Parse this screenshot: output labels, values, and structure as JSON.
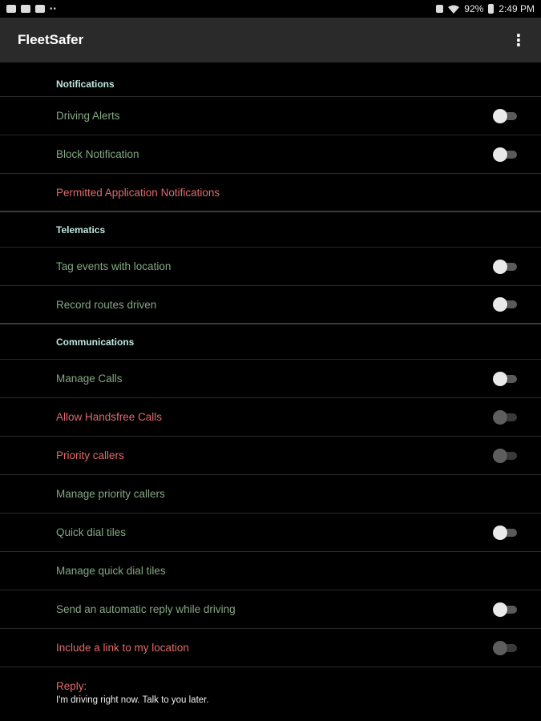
{
  "status_bar": {
    "battery": "92%",
    "time": "2:49 PM",
    "left_icons": [
      "image-icon",
      "settings-icon",
      "mail-icon"
    ],
    "right_icons": [
      "battery-saver-icon",
      "wifi-icon",
      "battery-icon"
    ]
  },
  "app_bar": {
    "title": "FleetSafer",
    "overflow_icon": "more-vert-icon"
  },
  "colors": {
    "section_header": "#bfe6e0",
    "enabled_item": "#84a884",
    "warning_item": "#e06a6a",
    "app_bar_bg": "#2a2a2a"
  },
  "sections": {
    "notifications": {
      "header": "Notifications",
      "driving_alerts": {
        "label": "Driving Alerts",
        "toggle": "off"
      },
      "block_notification": {
        "label": "Block Notification",
        "toggle": "off"
      },
      "permitted_apps": {
        "label": "Permitted Application Notifications"
      }
    },
    "telematics": {
      "header": "Telematics",
      "tag_events": {
        "label": "Tag events with location",
        "toggle": "off"
      },
      "record_routes": {
        "label": "Record routes driven",
        "toggle": "off"
      }
    },
    "communications": {
      "header": "Communications",
      "manage_calls": {
        "label": "Manage Calls",
        "toggle": "off"
      },
      "allow_handsfree": {
        "label": "Allow Handsfree Calls",
        "toggle": "off-disabled"
      },
      "priority_callers": {
        "label": "Priority callers",
        "toggle": "off-disabled"
      },
      "manage_priority_callers": {
        "label": "Manage priority callers"
      },
      "quick_dial_tiles": {
        "label": "Quick dial tiles",
        "toggle": "off"
      },
      "manage_quick_dial": {
        "label": "Manage quick dial tiles"
      },
      "auto_reply": {
        "label": "Send an automatic reply while driving",
        "toggle": "off"
      },
      "include_location": {
        "label": "Include a link to my location",
        "toggle": "off-disabled"
      },
      "reply": {
        "label": "Reply:",
        "value": "I'm driving right now. Talk to you later."
      }
    }
  }
}
